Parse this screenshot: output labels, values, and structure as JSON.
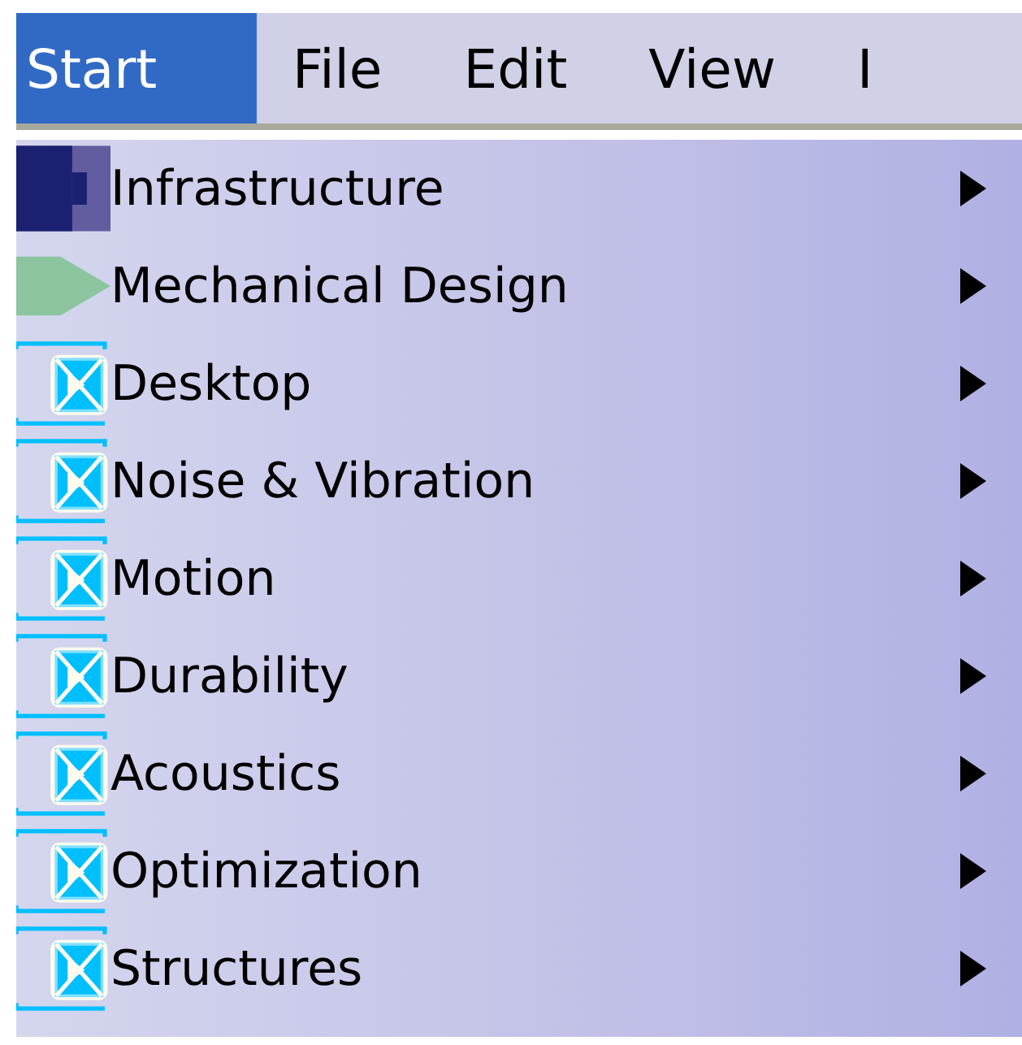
{
  "menu_bar": [
    {
      "label": "Start",
      "selected": true
    },
    {
      "label": "File",
      "selected": false
    },
    {
      "label": "Edit",
      "selected": false
    },
    {
      "label": "View",
      "selected": false
    },
    {
      "label": "I",
      "selected": false
    }
  ],
  "start_menu": {
    "items": [
      {
        "label": "Infrastructure",
        "kind": "blocks",
        "submenu": true
      },
      {
        "label": "Mechanical Design",
        "kind": "triangle",
        "submenu": true
      },
      {
        "label": "Desktop",
        "kind": "workbench",
        "submenu": true
      },
      {
        "label": "Noise & Vibration",
        "kind": "workbench",
        "submenu": true
      },
      {
        "label": "Motion",
        "kind": "workbench",
        "submenu": true
      },
      {
        "label": "Durability",
        "kind": "workbench",
        "submenu": true
      },
      {
        "label": "Acoustics",
        "kind": "workbench",
        "submenu": true
      },
      {
        "label": "Optimization",
        "kind": "workbench",
        "submenu": true
      },
      {
        "label": "Structures",
        "kind": "workbench",
        "submenu": true
      }
    ]
  }
}
